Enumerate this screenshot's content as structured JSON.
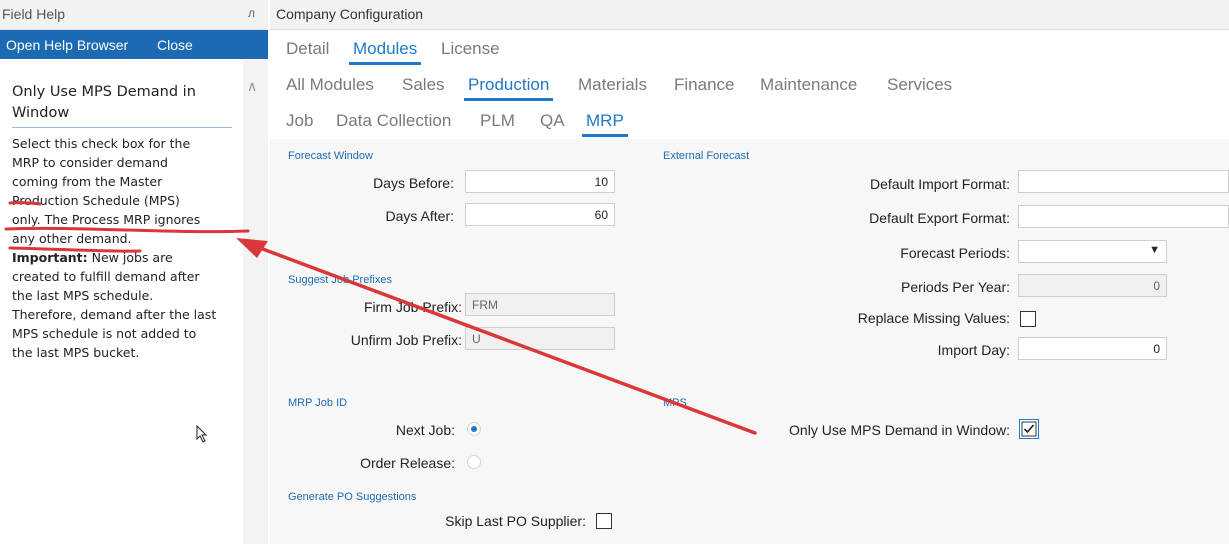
{
  "help_panel": {
    "title": "Field Help",
    "pin_icon": "pin-icon",
    "open_help_browser": "Open Help Browser",
    "close": "Close",
    "heading": "Only Use MPS Demand in Window",
    "body_lines": [
      "Select this check box for the",
      "MRP to consider demand",
      "coming from the Master",
      "Production Schedule (MPS)",
      "only. The Process MRP ignores",
      "any other demand."
    ],
    "important_label": "Important:",
    "important_first": " New jobs are",
    "important_lines": [
      "created to fulfill demand after",
      "the last MPS schedule.",
      "Therefore, demand after the last",
      "MPS schedule is not added to",
      "the last MPS bucket."
    ]
  },
  "content": {
    "title": "Company Configuration",
    "tabs_row1": [
      {
        "label": "Detail",
        "active": false
      },
      {
        "label": "Modules",
        "active": true
      },
      {
        "label": "License",
        "active": false
      }
    ],
    "tabs_row2": [
      {
        "label": "All Modules",
        "active": false
      },
      {
        "label": "Sales",
        "active": false
      },
      {
        "label": "Production",
        "active": true
      },
      {
        "label": "Materials",
        "active": false
      },
      {
        "label": "Finance",
        "active": false
      },
      {
        "label": "Maintenance",
        "active": false
      },
      {
        "label": "Services",
        "active": false
      }
    ],
    "tabs_row3": [
      {
        "label": "Job",
        "active": false
      },
      {
        "label": "Data Collection",
        "active": false
      },
      {
        "label": "PLM",
        "active": false
      },
      {
        "label": "QA",
        "active": false
      },
      {
        "label": "MRP",
        "active": true
      }
    ]
  },
  "forecast_window": {
    "group": "Forecast Window",
    "days_before_label": "Days Before:",
    "days_before_value": "10",
    "days_after_label": "Days After:",
    "days_after_value": "60"
  },
  "suggest_job_prefixes": {
    "group": "Suggest Job Prefixes",
    "firm_label": "Firm Job Prefix:",
    "firm_value": "FRM",
    "unfirm_label": "Unfirm Job Prefix:",
    "unfirm_value": "U"
  },
  "mrp_job_id": {
    "group": "MRP Job ID",
    "next_job_label": "Next Job:",
    "next_job_selected": true,
    "order_release_label": "Order Release:",
    "order_release_selected": false
  },
  "generate_po": {
    "group": "Generate PO Suggestions",
    "skip_last_label": "Skip Last PO Supplier:",
    "skip_last_checked": false
  },
  "external_forecast": {
    "group": "External Forecast",
    "import_format_label": "Default Import Format:",
    "import_format_value": "",
    "export_format_label": "Default Export Format:",
    "export_format_value": "",
    "forecast_periods_label": "Forecast Periods:",
    "forecast_periods_value": "",
    "periods_per_year_label": "Periods Per Year:",
    "periods_per_year_value": "0",
    "replace_missing_label": "Replace Missing Values:",
    "replace_missing_checked": false,
    "import_day_label": "Import Day:",
    "import_day_value": "0"
  },
  "mps": {
    "group": "MPS",
    "only_use_label": "Only Use MPS Demand in Window:",
    "only_use_checked": true
  },
  "annotation_color": "#d9383a"
}
